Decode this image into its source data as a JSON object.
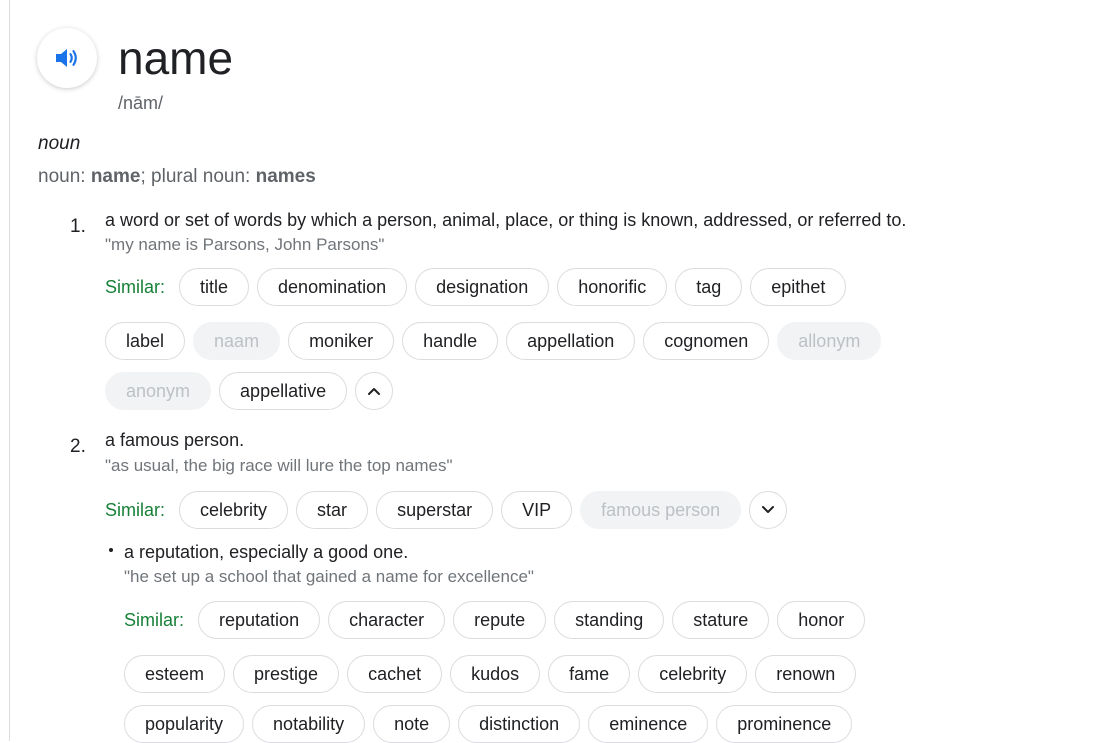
{
  "entry": {
    "word": "name",
    "phonetic": "/nām/",
    "part_of_speech": "noun",
    "forms": {
      "prefix": "noun:",
      "word": "name",
      "sep": "; plural noun:",
      "plural": "names"
    }
  },
  "similar_label": "Similar:",
  "senses": [
    {
      "number": "1.",
      "definition": "a word or set of words by which a person, animal, place, or thing is known, addressed, or referred to.",
      "example": "\"my name is Parsons, John Parsons\"",
      "similar_rows": [
        [
          {
            "text": "title"
          },
          {
            "text": "denomination"
          },
          {
            "text": "designation"
          },
          {
            "text": "honorific"
          },
          {
            "text": "tag"
          },
          {
            "text": "epithet"
          }
        ],
        [
          {
            "text": "label"
          },
          {
            "text": "naam",
            "dim": true
          },
          {
            "text": "moniker"
          },
          {
            "text": "handle"
          },
          {
            "text": "appellation"
          },
          {
            "text": "cognomen"
          },
          {
            "text": "allonym",
            "dim": true
          }
        ],
        [
          {
            "text": "anonym",
            "dim": true
          },
          {
            "text": "appellative"
          }
        ]
      ],
      "expander": "chevron-up-icon"
    },
    {
      "number": "2.",
      "definition": "a famous person.",
      "example": "\"as usual, the big race will lure the top names\"",
      "similar_rows": [
        [
          {
            "text": "celebrity"
          },
          {
            "text": "star"
          },
          {
            "text": "superstar"
          },
          {
            "text": "VIP"
          },
          {
            "text": "famous person",
            "dim": true
          }
        ]
      ],
      "expander": "chevron-down-icon"
    },
    {
      "number": "•",
      "definition": "a reputation, especially a good one.",
      "example": "\"he set up a school that gained a name for excellence\"",
      "similar_rows": [
        [
          {
            "text": "reputation"
          },
          {
            "text": "character"
          },
          {
            "text": "repute"
          },
          {
            "text": "standing"
          },
          {
            "text": "stature"
          },
          {
            "text": "honor"
          }
        ],
        [
          {
            "text": "esteem"
          },
          {
            "text": "prestige"
          },
          {
            "text": "cachet"
          },
          {
            "text": "kudos"
          },
          {
            "text": "fame"
          },
          {
            "text": "celebrity"
          },
          {
            "text": "renown"
          }
        ],
        [
          {
            "text": "popularity"
          },
          {
            "text": "notability"
          },
          {
            "text": "note"
          },
          {
            "text": "distinction"
          },
          {
            "text": "eminence"
          },
          {
            "text": "prominence"
          }
        ]
      ]
    }
  ],
  "colors": {
    "similar": "#188038",
    "speaker": "#1a73e8",
    "muted": "#70757a"
  }
}
